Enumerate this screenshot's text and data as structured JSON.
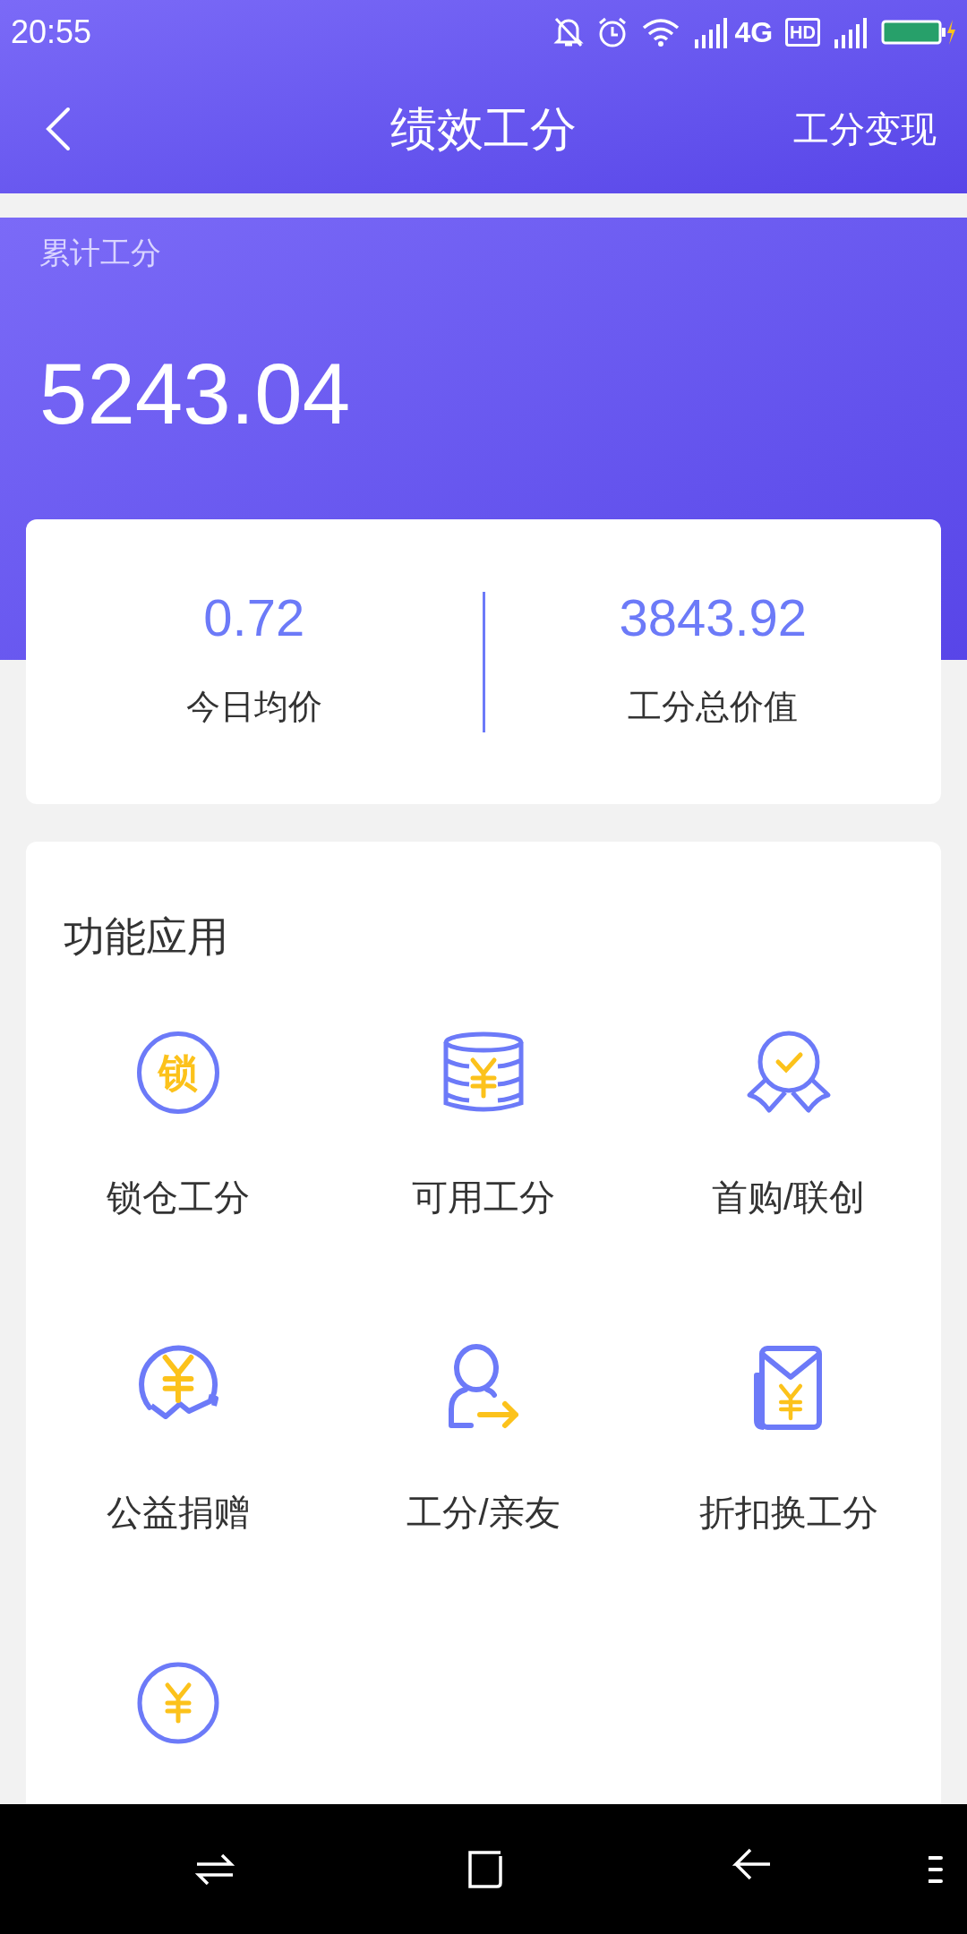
{
  "status_bar": {
    "time": "20:55",
    "network": "4G",
    "hd": "HD"
  },
  "header": {
    "title": "绩效工分",
    "action": "工分变现"
  },
  "total": {
    "label": "累计工分",
    "value": "5243.04"
  },
  "stats": [
    {
      "value": "0.72",
      "label": "今日均价"
    },
    {
      "value": "3843.92",
      "label": "工分总价值"
    }
  ],
  "functions": {
    "title": "功能应用",
    "items": [
      {
        "kind": "lock-coin",
        "glyph": "锁",
        "label": "锁仓工分"
      },
      {
        "kind": "coin-stack",
        "label": "可用工分"
      },
      {
        "kind": "badge",
        "label": "首购/联创"
      },
      {
        "kind": "donate",
        "label": "公益捐赠"
      },
      {
        "kind": "person-transfer",
        "label": "工分/亲友"
      },
      {
        "kind": "envelope",
        "label": "折扣换工分"
      },
      {
        "kind": "yen-coin"
      }
    ]
  }
}
